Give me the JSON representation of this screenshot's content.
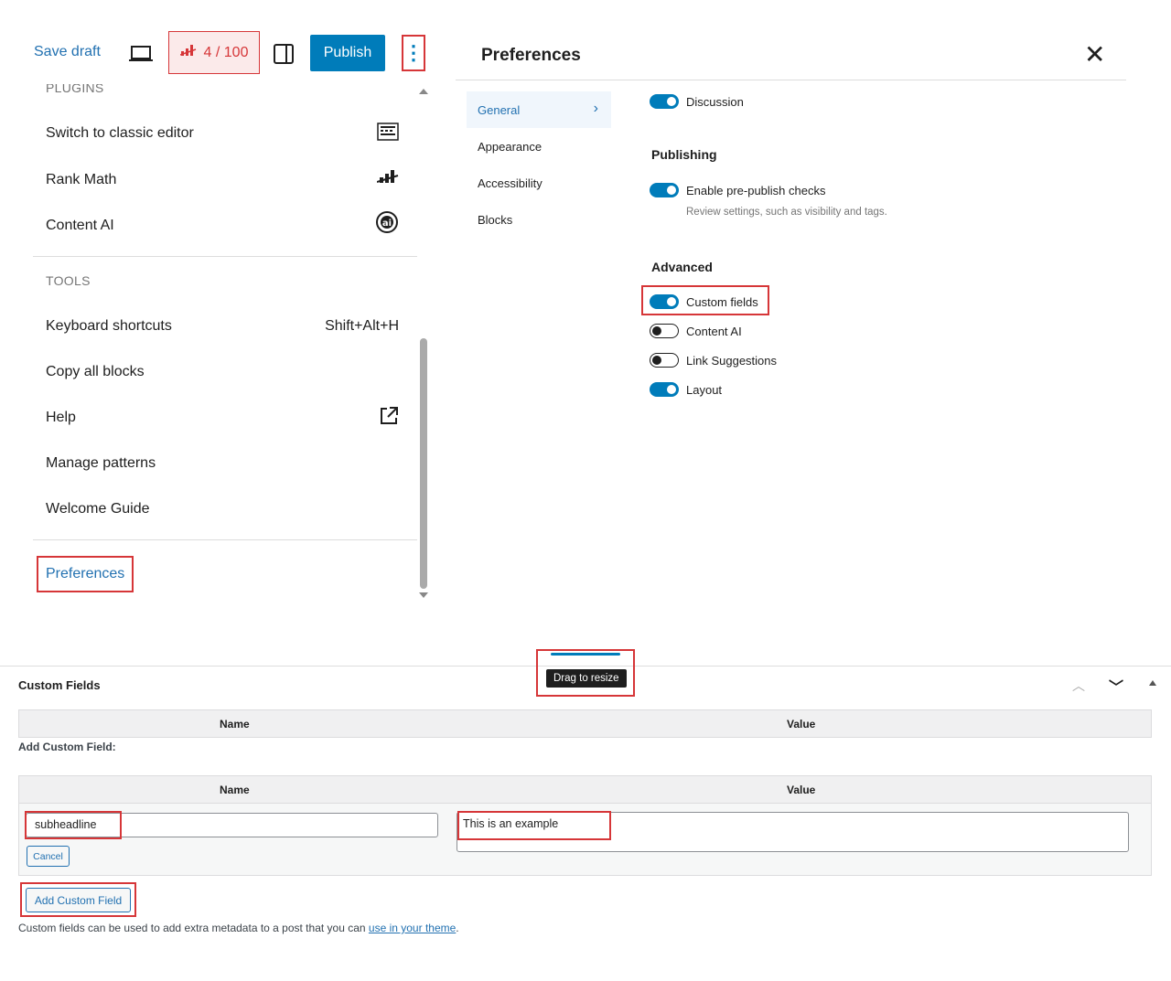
{
  "toolbar": {
    "save_draft": "Save draft",
    "score": "4 / 100",
    "publish": "Publish"
  },
  "menu": {
    "plugins_heading": "PLUGINS",
    "plugins": [
      {
        "label": "Switch to classic editor",
        "icon": "keyboard-icon"
      },
      {
        "label": "Rank Math",
        "icon": "rank-math-icon"
      },
      {
        "label": "Content AI",
        "icon": "content-ai-icon"
      }
    ],
    "tools_heading": "TOOLS",
    "tools": [
      {
        "label": "Keyboard shortcuts",
        "shortcut": "Shift+Alt+H"
      },
      {
        "label": "Copy all blocks"
      },
      {
        "label": "Help",
        "icon": "external-link-icon"
      },
      {
        "label": "Manage patterns"
      },
      {
        "label": "Welcome Guide"
      }
    ],
    "preferences": "Preferences"
  },
  "preferences_modal": {
    "title": "Preferences",
    "tabs": [
      "General",
      "Appearance",
      "Accessibility",
      "Blocks"
    ],
    "active_tab": "General",
    "discussion": {
      "label": "Discussion",
      "on": true
    },
    "publishing_heading": "Publishing",
    "prepublish": {
      "label": "Enable pre-publish checks",
      "hint": "Review settings, such as visibility and tags.",
      "on": true
    },
    "advanced_heading": "Advanced",
    "advanced": [
      {
        "label": "Custom fields",
        "on": true
      },
      {
        "label": "Content AI",
        "on": false
      },
      {
        "label": "Link Suggestions",
        "on": false
      },
      {
        "label": "Layout",
        "on": true
      }
    ]
  },
  "resize_tooltip": "Drag to resize",
  "custom_fields": {
    "title": "Custom Fields",
    "col_name": "Name",
    "col_value": "Value",
    "add_label": "Add Custom Field:",
    "name_value": "subheadline",
    "value_value": "This is an example",
    "cancel": "Cancel",
    "add_button": "Add Custom Field",
    "description": "Custom fields can be used to add extra metadata to a post that you can ",
    "description_link": "use in your theme",
    "description_end": "."
  },
  "colors": {
    "accent": "#007cba",
    "link": "#2271b1",
    "highlight": "#d63638"
  }
}
